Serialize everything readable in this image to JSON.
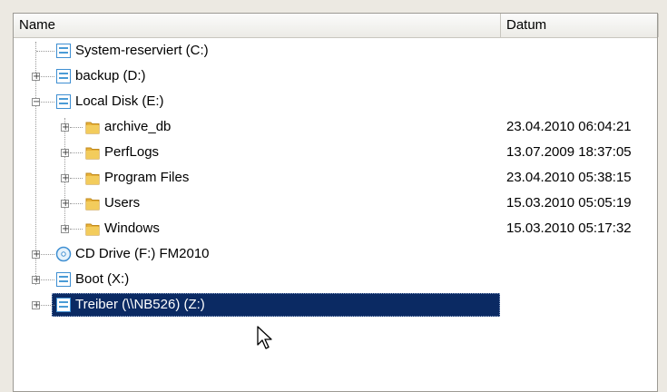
{
  "columns": {
    "name": "Name",
    "date": "Datum"
  },
  "items": [
    {
      "label": "System-reserviert (C:)",
      "date": "",
      "icon": "drive-icon"
    },
    {
      "label": "backup (D:)",
      "date": "",
      "icon": "drive-icon"
    },
    {
      "label": "Local Disk (E:)",
      "date": "",
      "icon": "drive-icon"
    },
    {
      "label": "archive_db",
      "date": "23.04.2010 06:04:21",
      "icon": "folder-icon"
    },
    {
      "label": "PerfLogs",
      "date": "13.07.2009 18:37:05",
      "icon": "folder-icon"
    },
    {
      "label": "Program Files",
      "date": "23.04.2010 05:38:15",
      "icon": "folder-icon"
    },
    {
      "label": "Users",
      "date": "15.03.2010 05:05:19",
      "icon": "folder-icon"
    },
    {
      "label": "Windows",
      "date": "15.03.2010 05:17:32",
      "icon": "folder-icon"
    },
    {
      "label": "CD Drive (F:) FM2010",
      "date": "",
      "icon": "cd-drive-icon"
    },
    {
      "label": "Boot (X:)",
      "date": "",
      "icon": "drive-icon"
    },
    {
      "label": "Treiber (\\\\NB526) (Z:)",
      "date": "",
      "icon": "network-drive-icon"
    }
  ],
  "selected_index": 10,
  "colors": {
    "selection": "#0b2a63",
    "folder": "#e8b23a",
    "drive": "#4a9bd6"
  }
}
